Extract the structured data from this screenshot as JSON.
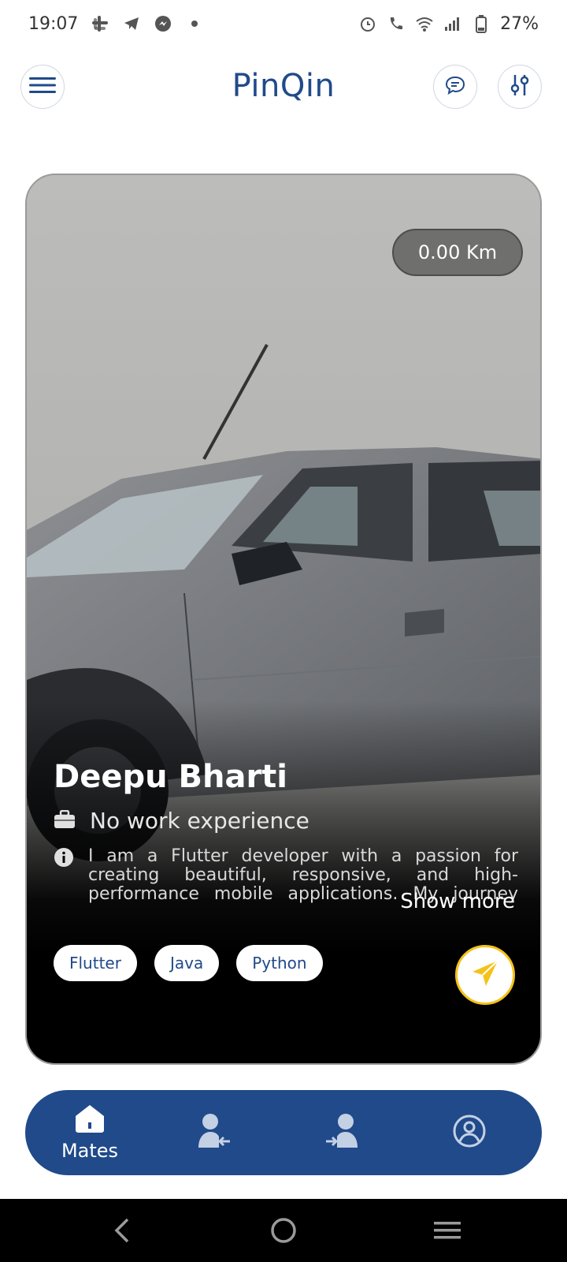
{
  "status_bar": {
    "time": "19:07",
    "battery": "27%",
    "left_icons": [
      "slack-icon",
      "telegram-icon",
      "messenger-icon",
      "dot-icon"
    ],
    "right_icons": [
      "alarm-icon",
      "wifi-call-icon",
      "wifi-icon",
      "signal-icon",
      "battery-icon"
    ]
  },
  "app_bar": {
    "title": "PinQin",
    "menu_icon": "hamburger-menu-icon",
    "chat_icon": "chat-bubble-icon",
    "filter_icon": "sliders-filter-icon"
  },
  "profile_card": {
    "distance": "0.00 Km",
    "name": "Deepu Bharti",
    "work": "No work experience",
    "bio": "I am a Flutter developer with a passion for creating beautiful, responsive, and high-performance mobile applications. My journey into...",
    "show_more": "Show more",
    "skills": [
      "Flutter",
      "Java",
      "Python"
    ],
    "send_icon": "paper-plane-icon",
    "accent_color": "#f4c21a"
  },
  "bottom_nav": {
    "items": [
      {
        "icon": "home-icon",
        "label": "Mates",
        "active": true
      },
      {
        "icon": "user-incoming-icon",
        "label": ""
      },
      {
        "icon": "user-outgoing-icon",
        "label": ""
      },
      {
        "icon": "profile-circle-icon",
        "label": ""
      }
    ],
    "background": "#204a8a"
  },
  "system_nav": {
    "back_icon": "back-chevron-icon",
    "home_icon": "home-circle-icon",
    "recents_icon": "recents-lines-icon"
  }
}
